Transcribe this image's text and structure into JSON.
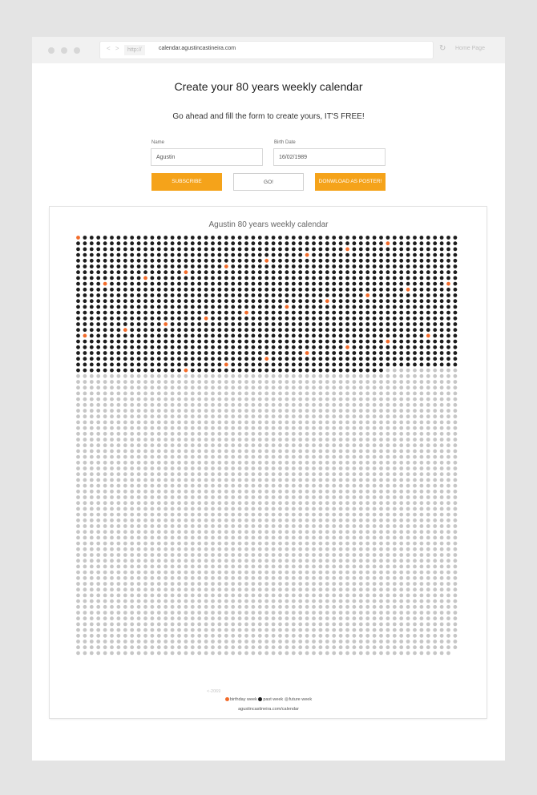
{
  "browser": {
    "nav_arrows": "< >",
    "protocol": "http://",
    "url": "calendar.agustincastineira.com",
    "reload_icon": "reload-icon",
    "home_label": "Home Page"
  },
  "page": {
    "title": "Create your 80 years weekly calendar",
    "subtitle": "Go ahead and fill the form to create yours, IT'S FREE!"
  },
  "form": {
    "name_label": "Name",
    "name_value": "Agustin",
    "birth_label": "Birth Date",
    "birth_value": "16/02/1989",
    "subscribe_label": "SUBSCRIBE",
    "go_label": "GO!",
    "download_label": "DONWLOAD AS POSTER!"
  },
  "calendar": {
    "title": "Agustin 80 years weekly calendar",
    "years": 80,
    "weeks_per_year": 52,
    "weeks_lived": 1357,
    "end_year_label": "<-2069",
    "colors": {
      "birthday": "#f26b2a",
      "past": "#1c1c1c",
      "future": "#c6c6c6"
    },
    "legend": {
      "birthday": "birthday week",
      "past": "past week",
      "future": "future week"
    },
    "credit": "agustincastineira.com/calendar"
  }
}
